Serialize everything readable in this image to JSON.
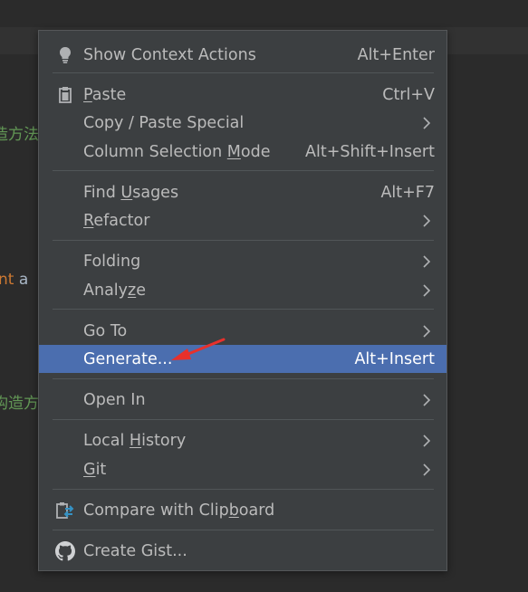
{
  "editor": {
    "fragment_1": "造方法",
    "fragment_2_keyword": "nt",
    "fragment_2_plain": " a",
    "fragment_3": "构造方"
  },
  "menu": {
    "show_context_actions": {
      "label": "Show Context Actions",
      "shortcut": "Alt+Enter",
      "icon": "lightbulb-icon"
    },
    "paste": {
      "mnemonic": "P",
      "rest": "aste",
      "shortcut": "Ctrl+V",
      "icon": "clipboard-icon"
    },
    "copy_paste_special": {
      "label": "Copy / Paste Special"
    },
    "column_selection_mode": {
      "before": "Column Selection ",
      "mnemonic": "M",
      "after": "ode",
      "shortcut": "Alt+Shift+Insert"
    },
    "find_usages": {
      "before": "Find ",
      "mnemonic": "U",
      "after": "sages",
      "shortcut": "Alt+F7"
    },
    "refactor": {
      "mnemonic": "R",
      "rest": "efactor"
    },
    "folding": {
      "label": "Folding"
    },
    "analyze": {
      "before": "Analy",
      "mnemonic": "z",
      "after": "e"
    },
    "go_to": {
      "label": "Go To"
    },
    "generate": {
      "label": "Generate...",
      "shortcut": "Alt+Insert"
    },
    "open_in": {
      "label": "Open In"
    },
    "local_history": {
      "before": "Local ",
      "mnemonic": "H",
      "after": "istory"
    },
    "git": {
      "mnemonic": "G",
      "rest": "it"
    },
    "compare_with_clipboard": {
      "before": "Compare with Clip",
      "mnemonic": "b",
      "after": "oard",
      "icon": "compare-clipboard-icon"
    },
    "create_gist": {
      "label": "Create Gist...",
      "icon": "github-icon"
    }
  },
  "colors": {
    "menu_background": "#3c3f41",
    "selection": "#4b6eaf",
    "text": "#bbbbbb",
    "annotation_arrow": "#e8302b"
  }
}
